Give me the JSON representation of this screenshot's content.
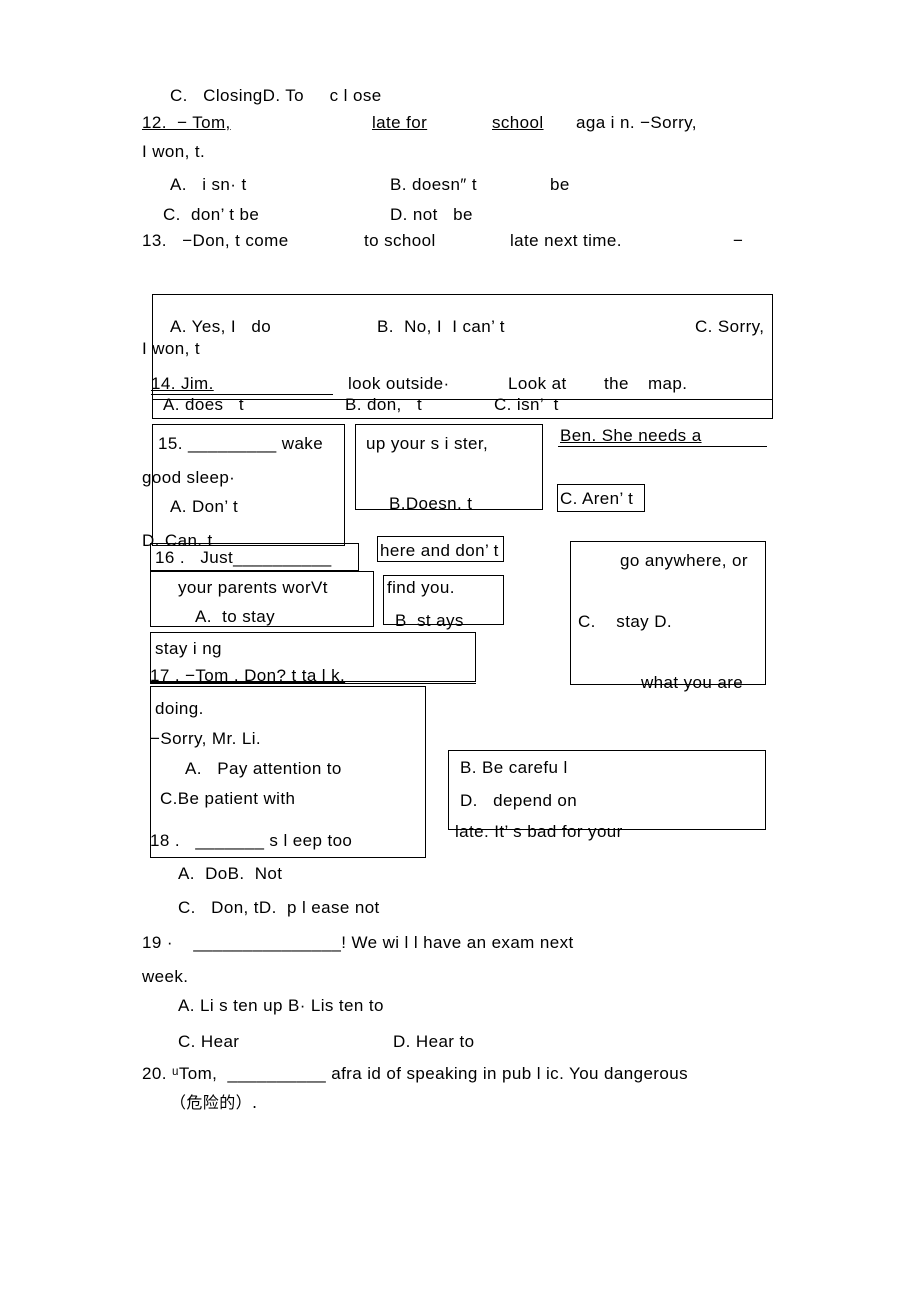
{
  "document": {
    "type": "scanned-exam-worksheet",
    "lines": [
      {
        "id": "l_c_closing",
        "text": "C.   ClosingD. To     c l ose"
      },
      {
        "id": "l_q12",
        "text": "12.  − Tom,"
      },
      {
        "id": "l_q12b",
        "text": "late for"
      },
      {
        "id": "l_q12c",
        "text": "school"
      },
      {
        "id": "l_q12d",
        "text": "aga i n. −Sorry,"
      },
      {
        "id": "l_q12e",
        "text": "I won, t."
      },
      {
        "id": "l_q12_a",
        "text": "A.   i sn· t"
      },
      {
        "id": "l_q12_b",
        "text": "B. doesn″ t"
      },
      {
        "id": "l_q12_bb",
        "text": "be"
      },
      {
        "id": "l_q12_c",
        "text": "C.  don’ t be"
      },
      {
        "id": "l_q12_d",
        "text": "D. not   be"
      },
      {
        "id": "l_q13",
        "text": "13.   −Don, t come"
      },
      {
        "id": "l_q13b",
        "text": "to school"
      },
      {
        "id": "l_q13c",
        "text": "late next time."
      },
      {
        "id": "l_q13d",
        "text": "−"
      },
      {
        "id": "l_q13_a",
        "text": "A. Yes, I   do"
      },
      {
        "id": "l_q13_b",
        "text": "B.  No, I  I can’ t"
      },
      {
        "id": "l_q13_c",
        "text": "C. Sorry,"
      },
      {
        "id": "l_q13_c2",
        "text": "I won, t"
      },
      {
        "id": "l_q14",
        "text": "14. Jim."
      },
      {
        "id": "l_q14b",
        "text": "look outside·"
      },
      {
        "id": "l_q14c",
        "text": "Look at"
      },
      {
        "id": "l_q14d",
        "text": "the"
      },
      {
        "id": "l_q14e",
        "text": "map."
      },
      {
        "id": "l_q14_a",
        "text": "A. does   t"
      },
      {
        "id": "l_q14_b",
        "text": "B. don,   t"
      },
      {
        "id": "l_q14_c",
        "text": "C. isn’  t"
      },
      {
        "id": "l_q15",
        "text": "15. _________ wake"
      },
      {
        "id": "l_q15b",
        "text": "up your s i ster,"
      },
      {
        "id": "l_q15c",
        "text": "Ben. She needs a"
      },
      {
        "id": "l_q15d",
        "text": "good sleep·"
      },
      {
        "id": "l_q15_a",
        "text": "A. Don’ t"
      },
      {
        "id": "l_q15_b",
        "text": "B.Doesn. t"
      },
      {
        "id": "l_q15_c",
        "text": "C. Aren’ t"
      },
      {
        "id": "l_q15_d",
        "text": "D. Can. t"
      },
      {
        "id": "l_q16",
        "text": "16 .   Just__________"
      },
      {
        "id": "l_q16b",
        "text": "here and don’ t"
      },
      {
        "id": "l_q16c",
        "text": "go anywhere, or"
      },
      {
        "id": "l_q16d",
        "text": "your parents worVt"
      },
      {
        "id": "l_q16e",
        "text": "find you."
      },
      {
        "id": "l_q16_a",
        "text": "A.  to stay"
      },
      {
        "id": "l_q16_b",
        "text": "B  st ays"
      },
      {
        "id": "l_q16_c",
        "text": "C.    stay D."
      },
      {
        "id": "l_q16_d",
        "text": "stay i ng"
      },
      {
        "id": "l_q17",
        "text": "17 . −Tom . Don? t ta l k."
      },
      {
        "id": "l_q17b",
        "text": "what you are"
      },
      {
        "id": "l_q17c",
        "text": "doing."
      },
      {
        "id": "l_q17d",
        "text": "−Sorry, Mr. Li."
      },
      {
        "id": "l_q17_a",
        "text": "A.   Pay attention to"
      },
      {
        "id": "l_q17_b",
        "text": "B. Be carefu l"
      },
      {
        "id": "l_q17_c",
        "text": "C.Be patient with"
      },
      {
        "id": "l_q17_d",
        "text": "D.   depend on"
      },
      {
        "id": "l_q18",
        "text": "18 .   _______ s l eep too"
      },
      {
        "id": "l_q18b",
        "text": "late. It’ s bad for your"
      },
      {
        "id": "l_q18_a",
        "text": "A.  DoB.  Not"
      },
      {
        "id": "l_q18_c",
        "text": "C.   Don, tD.  p l ease not"
      },
      {
        "id": "l_q19",
        "text": "19 ·    _______________! We wi l l have an exam next"
      },
      {
        "id": "l_q19b",
        "text": "week."
      },
      {
        "id": "l_q19_a",
        "text": "A. Li s ten up B· Lis ten to"
      },
      {
        "id": "l_q19_c",
        "text": "C. Hear"
      },
      {
        "id": "l_q19_d",
        "text": "D. Hear to"
      },
      {
        "id": "l_q20",
        "text": "20. ᵘTom,  __________ afra id of speaking in pub l ic. You dangerous"
      },
      {
        "id": "l_q20b",
        "text": "（危险的）."
      }
    ]
  }
}
